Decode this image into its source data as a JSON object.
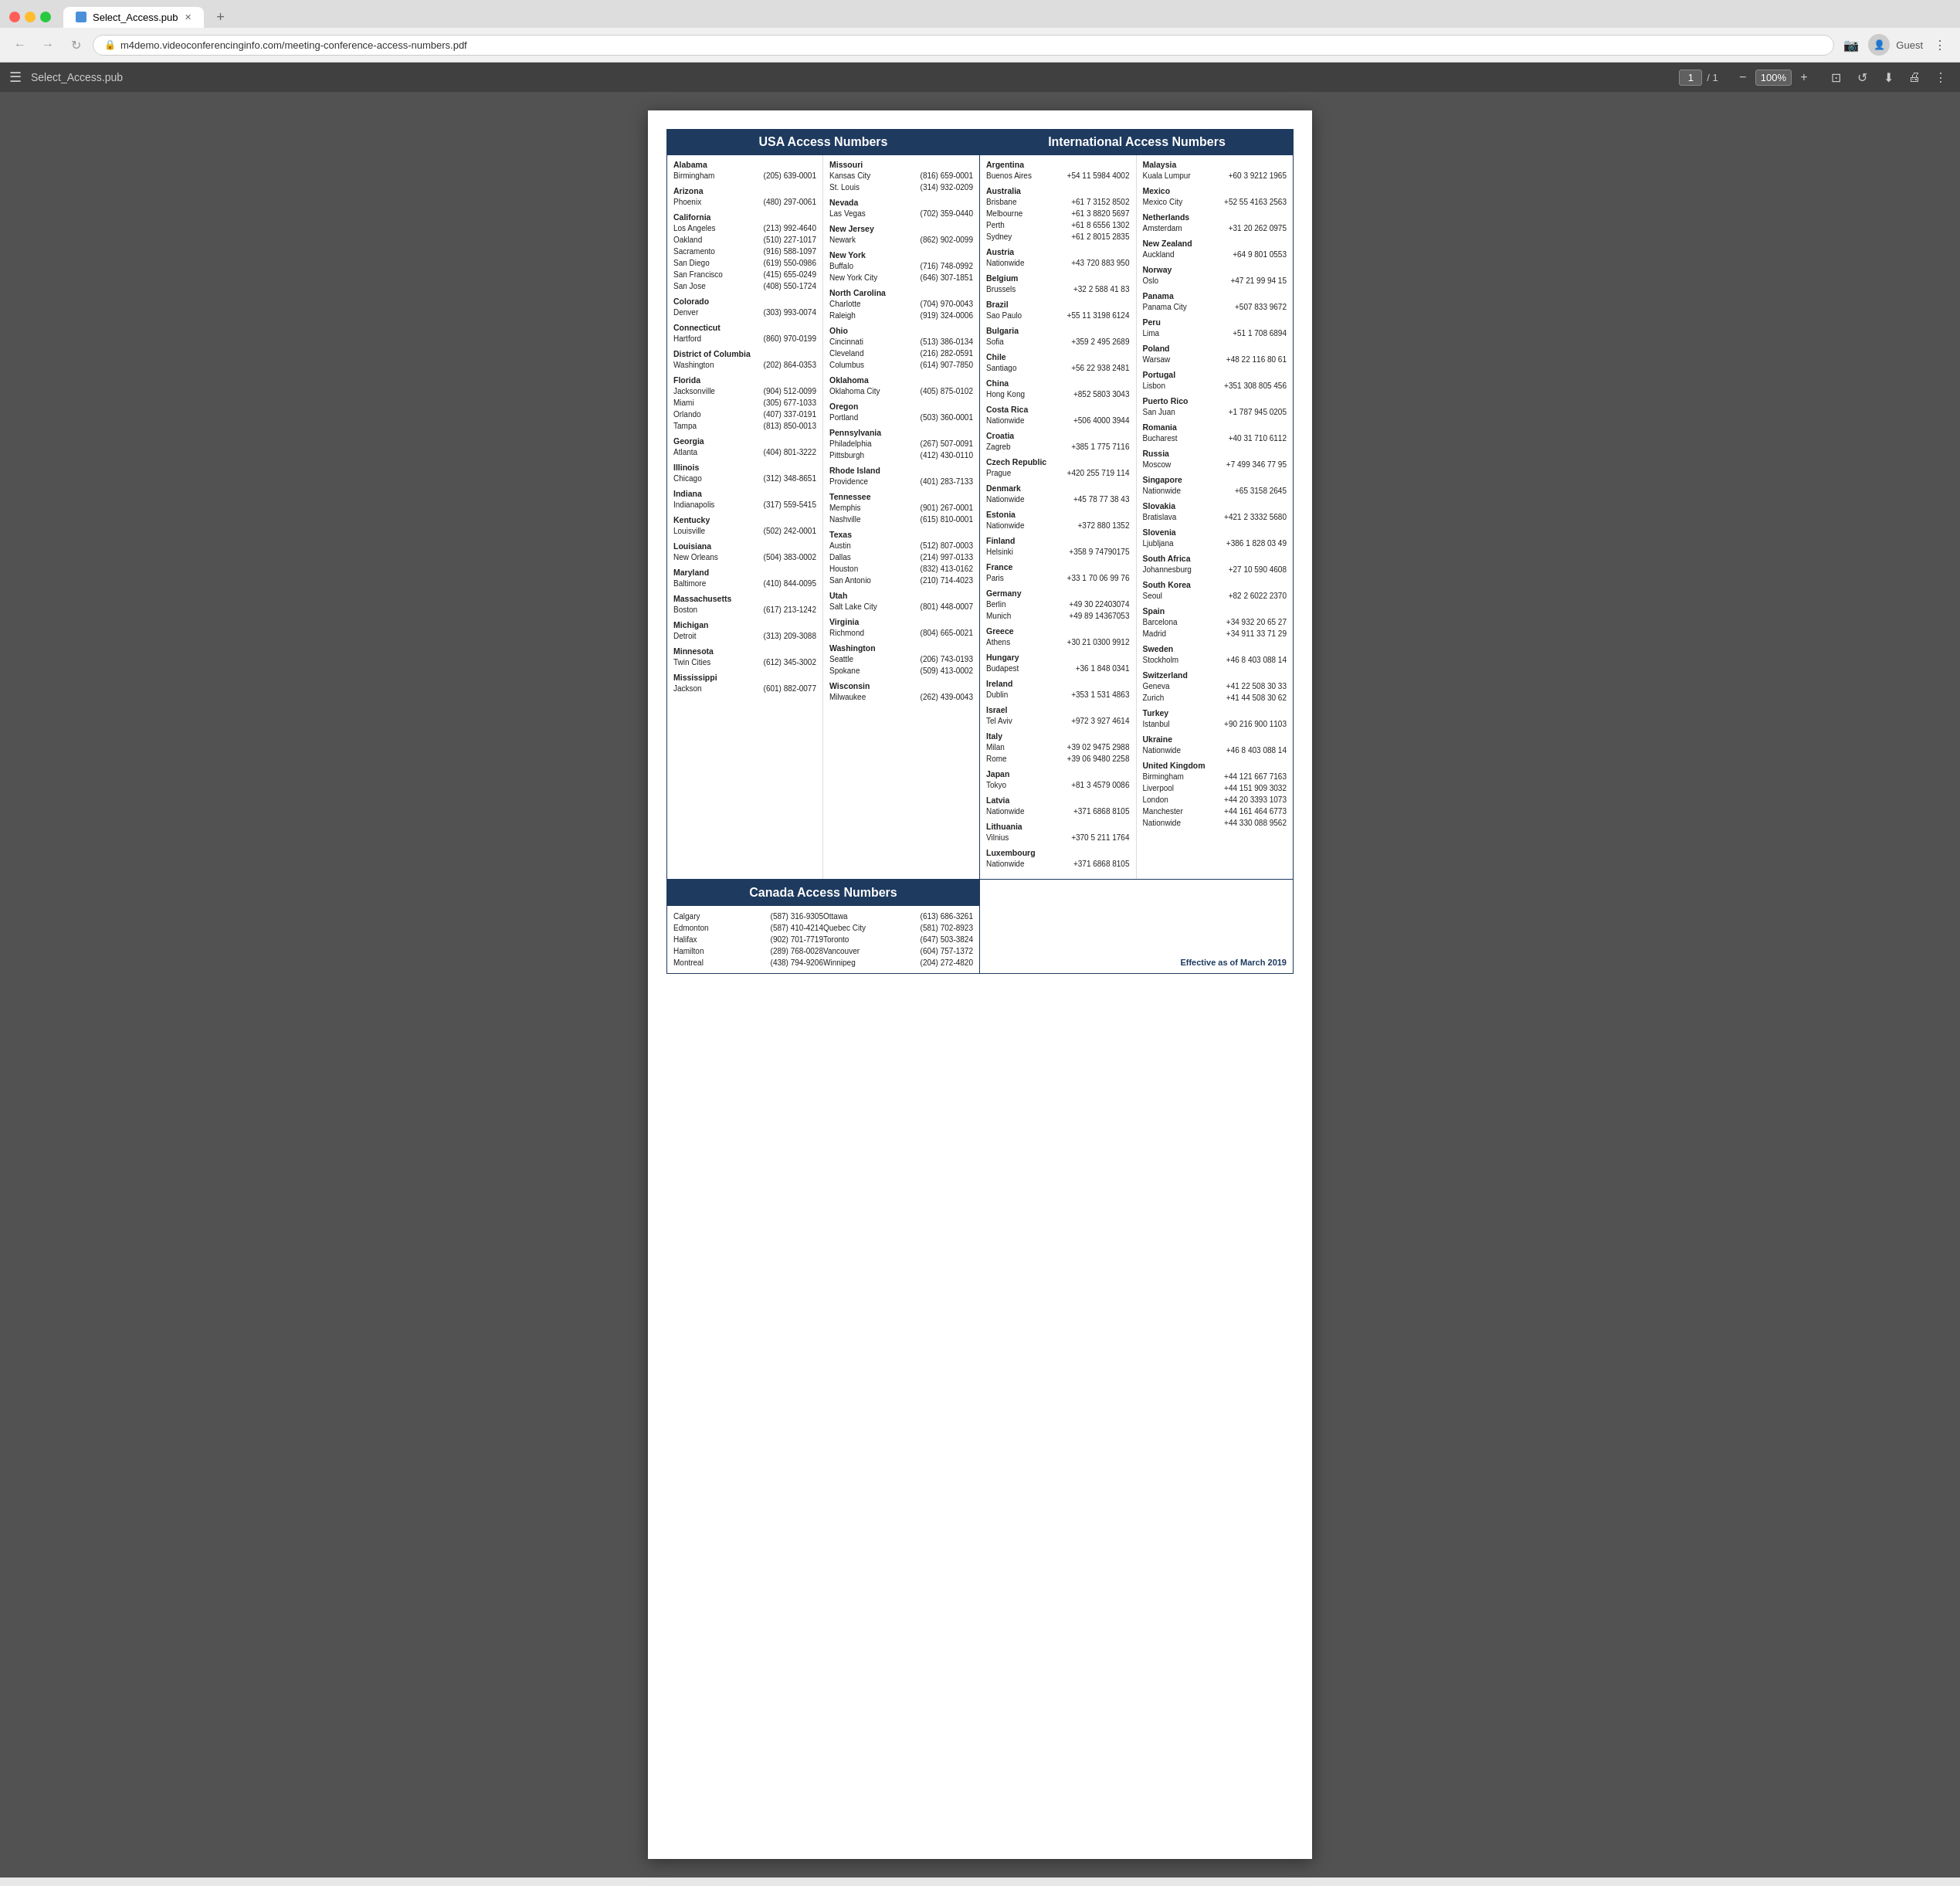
{
  "browser": {
    "tab_title": "Select_Access.pub",
    "url": "m4demo.videoconferencinginfo.com/meeting-conference-access-numbers.pdf",
    "page_indicator": "1 / 1",
    "zoom_level": "100%",
    "user_label": "Guest"
  },
  "pdf": {
    "title": "Select_Access.pub",
    "page_current": "1",
    "page_total": "1",
    "zoom": "100%"
  },
  "content": {
    "usa_header": "USA Access Numbers",
    "intl_header": "International Access Numbers",
    "canada_header": "Canada Access Numbers",
    "effective_date": "Effective as of March 2019",
    "usa_states": [
      {
        "state": "Alabama",
        "cities": [
          {
            "city": "Birmingham",
            "phone": "(205) 639-0001"
          }
        ]
      },
      {
        "state": "Arizona",
        "cities": [
          {
            "city": "Phoenix",
            "phone": "(480) 297-0061"
          }
        ]
      },
      {
        "state": "California",
        "cities": [
          {
            "city": "Los Angeles",
            "phone": "(213) 992-4640"
          },
          {
            "city": "Oakland",
            "phone": "(510) 227-1017"
          },
          {
            "city": "Sacramento",
            "phone": "(916) 588-1097"
          },
          {
            "city": "San Diego",
            "phone": "(619) 550-0986"
          },
          {
            "city": "San Francisco",
            "phone": "(415) 655-0249"
          },
          {
            "city": "San Jose",
            "phone": "(408) 550-1724"
          }
        ]
      },
      {
        "state": "Colorado",
        "cities": [
          {
            "city": "Denver",
            "phone": "(303) 993-0074"
          }
        ]
      },
      {
        "state": "Connecticut",
        "cities": [
          {
            "city": "Hartford",
            "phone": "(860) 970-0199"
          }
        ]
      },
      {
        "state": "District of Columbia",
        "cities": [
          {
            "city": "Washington",
            "phone": "(202) 864-0353"
          }
        ]
      },
      {
        "state": "Florida",
        "cities": [
          {
            "city": "Jacksonville",
            "phone": "(904) 512-0099"
          },
          {
            "city": "Miami",
            "phone": "(305) 677-1033"
          },
          {
            "city": "Orlando",
            "phone": "(407) 337-0191"
          },
          {
            "city": "Tampa",
            "phone": "(813) 850-0013"
          }
        ]
      },
      {
        "state": "Georgia",
        "cities": [
          {
            "city": "Atlanta",
            "phone": "(404) 801-3222"
          }
        ]
      },
      {
        "state": "Illinois",
        "cities": [
          {
            "city": "Chicago",
            "phone": "(312) 348-8651"
          }
        ]
      },
      {
        "state": "Indiana",
        "cities": [
          {
            "city": "Indianapolis",
            "phone": "(317) 559-5415"
          }
        ]
      },
      {
        "state": "Kentucky",
        "cities": [
          {
            "city": "Louisville",
            "phone": "(502) 242-0001"
          }
        ]
      },
      {
        "state": "Louisiana",
        "cities": [
          {
            "city": "New Orleans",
            "phone": "(504) 383-0002"
          }
        ]
      },
      {
        "state": "Maryland",
        "cities": [
          {
            "city": "Baltimore",
            "phone": "(410) 844-0095"
          }
        ]
      },
      {
        "state": "Massachusetts",
        "cities": [
          {
            "city": "Boston",
            "phone": "(617) 213-1242"
          }
        ]
      },
      {
        "state": "Michigan",
        "cities": [
          {
            "city": "Detroit",
            "phone": "(313) 209-3088"
          }
        ]
      },
      {
        "state": "Minnesota",
        "cities": [
          {
            "city": "Twin Cities",
            "phone": "(612) 345-3002"
          }
        ]
      },
      {
        "state": "Mississippi",
        "cities": [
          {
            "city": "Jackson",
            "phone": "(601) 882-0077"
          }
        ]
      }
    ],
    "usa_states_col2": [
      {
        "state": "Missouri",
        "cities": [
          {
            "city": "Kansas City",
            "phone": "(816) 659-0001"
          },
          {
            "city": "St. Louis",
            "phone": "(314) 932-0209"
          }
        ]
      },
      {
        "state": "Nevada",
        "cities": [
          {
            "city": "Las Vegas",
            "phone": "(702) 359-0440"
          }
        ]
      },
      {
        "state": "New Jersey",
        "cities": [
          {
            "city": "Newark",
            "phone": "(862) 902-0099"
          }
        ]
      },
      {
        "state": "New York",
        "cities": [
          {
            "city": "Buffalo",
            "phone": "(716) 748-0992"
          },
          {
            "city": "New York City",
            "phone": "(646) 307-1851"
          }
        ]
      },
      {
        "state": "North Carolina",
        "cities": [
          {
            "city": "Charlotte",
            "phone": "(704) 970-0043"
          },
          {
            "city": "Raleigh",
            "phone": "(919) 324-0006"
          }
        ]
      },
      {
        "state": "Ohio",
        "cities": [
          {
            "city": "Cincinnati",
            "phone": "(513) 386-0134"
          },
          {
            "city": "Cleveland",
            "phone": "(216) 282-0591"
          },
          {
            "city": "Columbus",
            "phone": "(614) 907-7850"
          }
        ]
      },
      {
        "state": "Oklahoma",
        "cities": [
          {
            "city": "Oklahoma City",
            "phone": "(405) 875-0102"
          }
        ]
      },
      {
        "state": "Oregon",
        "cities": [
          {
            "city": "Portland",
            "phone": "(503) 360-0001"
          }
        ]
      },
      {
        "state": "Pennsylvania",
        "cities": [
          {
            "city": "Philadelphia",
            "phone": "(267) 507-0091"
          },
          {
            "city": "Pittsburgh",
            "phone": "(412) 430-0110"
          }
        ]
      },
      {
        "state": "Rhode Island",
        "cities": [
          {
            "city": "Providence",
            "phone": "(401) 283-7133"
          }
        ]
      },
      {
        "state": "Tennessee",
        "cities": [
          {
            "city": "Memphis",
            "phone": "(901) 267-0001"
          },
          {
            "city": "Nashville",
            "phone": "(615) 810-0001"
          }
        ]
      },
      {
        "state": "Texas",
        "cities": [
          {
            "city": "Austin",
            "phone": "(512) 807-0003"
          },
          {
            "city": "Dallas",
            "phone": "(214) 997-0133"
          },
          {
            "city": "Houston",
            "phone": "(832) 413-0162"
          },
          {
            "city": "San Antonio",
            "phone": "(210) 714-4023"
          }
        ]
      },
      {
        "state": "Utah",
        "cities": [
          {
            "city": "Salt Lake City",
            "phone": "(801) 448-0007"
          }
        ]
      },
      {
        "state": "Virginia",
        "cities": [
          {
            "city": "Richmond",
            "phone": "(804) 665-0021"
          }
        ]
      },
      {
        "state": "Washington",
        "cities": [
          {
            "city": "Seattle",
            "phone": "(206) 743-0193"
          },
          {
            "city": "Spokane",
            "phone": "(509) 413-0002"
          }
        ]
      },
      {
        "state": "Wisconsin",
        "cities": [
          {
            "city": "Milwaukee",
            "phone": "(262) 439-0043"
          }
        ]
      }
    ],
    "international": [
      {
        "country": "Argentina",
        "cities": [
          {
            "city": "Buenos Aires",
            "phone": "+54 11 5984 4002"
          }
        ]
      },
      {
        "country": "Australia",
        "cities": [
          {
            "city": "Brisbane",
            "phone": "+61 7 3152 8502"
          },
          {
            "city": "Melbourne",
            "phone": "+61 3 8820 5697"
          },
          {
            "city": "Perth",
            "phone": "+61 8 6556 1302"
          },
          {
            "city": "Sydney",
            "phone": "+61 2 8015 2835"
          }
        ]
      },
      {
        "country": "Austria",
        "cities": [
          {
            "city": "Nationwide",
            "phone": "+43 720 883 950"
          }
        ]
      },
      {
        "country": "Belgium",
        "cities": [
          {
            "city": "Brussels",
            "phone": "+32 2 588 41 83"
          }
        ]
      },
      {
        "country": "Brazil",
        "cities": [
          {
            "city": "Sao Paulo",
            "phone": "+55 11 3198 6124"
          }
        ]
      },
      {
        "country": "Bulgaria",
        "cities": [
          {
            "city": "Sofia",
            "phone": "+359 2 495 2689"
          }
        ]
      },
      {
        "country": "Chile",
        "cities": [
          {
            "city": "Santiago",
            "phone": "+56 22 938 2481"
          }
        ]
      },
      {
        "country": "China",
        "cities": [
          {
            "city": "Hong Kong",
            "phone": "+852 5803 3043"
          }
        ]
      },
      {
        "country": "Costa Rica",
        "cities": [
          {
            "city": "Nationwide",
            "phone": "+506 4000 3944"
          }
        ]
      },
      {
        "country": "Croatia",
        "cities": [
          {
            "city": "Zagreb",
            "phone": "+385 1 775 7116"
          }
        ]
      },
      {
        "country": "Czech Republic",
        "cities": [
          {
            "city": "Prague",
            "phone": "+420 255 719 114"
          }
        ]
      },
      {
        "country": "Denmark",
        "cities": [
          {
            "city": "Nationwide",
            "phone": "+45 78 77 38 43"
          }
        ]
      },
      {
        "country": "Estonia",
        "cities": [
          {
            "city": "Nationwide",
            "phone": "+372 880 1352"
          }
        ]
      },
      {
        "country": "Finland",
        "cities": [
          {
            "city": "Helsinki",
            "phone": "+358 9 74790175"
          }
        ]
      },
      {
        "country": "France",
        "cities": [
          {
            "city": "Paris",
            "phone": "+33 1 70 06 99 76"
          }
        ]
      },
      {
        "country": "Germany",
        "cities": [
          {
            "city": "Berlin",
            "phone": "+49 30 22403074"
          },
          {
            "city": "Munich",
            "phone": "+49 89 14367053"
          }
        ]
      },
      {
        "country": "Greece",
        "cities": [
          {
            "city": "Athens",
            "phone": "+30 21 0300 9912"
          }
        ]
      },
      {
        "country": "Hungary",
        "cities": [
          {
            "city": "Budapest",
            "phone": "+36 1 848 0341"
          }
        ]
      },
      {
        "country": "Ireland",
        "cities": [
          {
            "city": "Dublin",
            "phone": "+353 1 531 4863"
          }
        ]
      },
      {
        "country": "Israel",
        "cities": [
          {
            "city": "Tel Aviv",
            "phone": "+972 3 927 4614"
          }
        ]
      },
      {
        "country": "Italy",
        "cities": [
          {
            "city": "Milan",
            "phone": "+39 02 9475 2988"
          },
          {
            "city": "Rome",
            "phone": "+39 06 9480 2258"
          }
        ]
      },
      {
        "country": "Japan",
        "cities": [
          {
            "city": "Tokyo",
            "phone": "+81 3 4579 0086"
          }
        ]
      },
      {
        "country": "Latvia",
        "cities": [
          {
            "city": "Nationwide",
            "phone": "+371 6868 8105"
          }
        ]
      },
      {
        "country": "Lithuania",
        "cities": [
          {
            "city": "Vilnius",
            "phone": "+370 5 211 1764"
          }
        ]
      },
      {
        "country": "Luxembourg",
        "cities": [
          {
            "city": "Nationwide",
            "phone": "+371 6868 8105"
          }
        ]
      }
    ],
    "international_col2": [
      {
        "country": "Malaysia",
        "cities": [
          {
            "city": "Kuala Lumpur",
            "phone": "+60 3 9212 1965"
          }
        ]
      },
      {
        "country": "Mexico",
        "cities": [
          {
            "city": "Mexico City",
            "phone": "+52 55 4163 2563"
          }
        ]
      },
      {
        "country": "Netherlands",
        "cities": [
          {
            "city": "Amsterdam",
            "phone": "+31 20 262 0975"
          }
        ]
      },
      {
        "country": "New Zealand",
        "cities": [
          {
            "city": "Auckland",
            "phone": "+64 9 801 0553"
          }
        ]
      },
      {
        "country": "Norway",
        "cities": [
          {
            "city": "Oslo",
            "phone": "+47 21 99 94 15"
          }
        ]
      },
      {
        "country": "Panama",
        "cities": [
          {
            "city": "Panama City",
            "phone": "+507 833 9672"
          }
        ]
      },
      {
        "country": "Peru",
        "cities": [
          {
            "city": "Lima",
            "phone": "+51 1 708 6894"
          }
        ]
      },
      {
        "country": "Poland",
        "cities": [
          {
            "city": "Warsaw",
            "phone": "+48 22 116 80 61"
          }
        ]
      },
      {
        "country": "Portugal",
        "cities": [
          {
            "city": "Lisbon",
            "phone": "+351 308 805 456"
          }
        ]
      },
      {
        "country": "Puerto Rico",
        "cities": [
          {
            "city": "San Juan",
            "phone": "+1 787 945 0205"
          }
        ]
      },
      {
        "country": "Romania",
        "cities": [
          {
            "city": "Bucharest",
            "phone": "+40 31 710 6112"
          }
        ]
      },
      {
        "country": "Russia",
        "cities": [
          {
            "city": "Moscow",
            "phone": "+7 499 346 77 95"
          }
        ]
      },
      {
        "country": "Singapore",
        "cities": [
          {
            "city": "Nationwide",
            "phone": "+65 3158 2645"
          }
        ]
      },
      {
        "country": "Slovakia",
        "cities": [
          {
            "city": "Bratislava",
            "phone": "+421 2 3332 5680"
          }
        ]
      },
      {
        "country": "Slovenia",
        "cities": [
          {
            "city": "Ljubljana",
            "phone": "+386 1 828 03 49"
          }
        ]
      },
      {
        "country": "South Africa",
        "cities": [
          {
            "city": "Johannesburg",
            "phone": "+27 10 590 4608"
          }
        ]
      },
      {
        "country": "South Korea",
        "cities": [
          {
            "city": "Seoul",
            "phone": "+82 2 6022 2370"
          }
        ]
      },
      {
        "country": "Spain",
        "cities": [
          {
            "city": "Barcelona",
            "phone": "+34 932 20 65 27"
          },
          {
            "city": "Madrid",
            "phone": "+34 911 33 71 29"
          }
        ]
      },
      {
        "country": "Sweden",
        "cities": [
          {
            "city": "Stockholm",
            "phone": "+46 8 403 088 14"
          }
        ]
      },
      {
        "country": "Switzerland",
        "cities": [
          {
            "city": "Geneva",
            "phone": "+41 22 508 30 33"
          },
          {
            "city": "Zurich",
            "phone": "+41 44 508 30 62"
          }
        ]
      },
      {
        "country": "Turkey",
        "cities": [
          {
            "city": "Istanbul",
            "phone": "+90 216 900 1103"
          }
        ]
      },
      {
        "country": "Ukraine",
        "cities": [
          {
            "city": "Nationwide",
            "phone": "+46 8 403 088 14"
          }
        ]
      },
      {
        "country": "United Kingdom",
        "cities": [
          {
            "city": "Birmingham",
            "phone": "+44 121 667 7163"
          },
          {
            "city": "Liverpool",
            "phone": "+44 151 909 3032"
          },
          {
            "city": "London",
            "phone": "+44 20 3393 1073"
          },
          {
            "city": "Manchester",
            "phone": "+44 161 464 6773"
          },
          {
            "city": "Nationwide",
            "phone": "+44 330 088 9562"
          }
        ]
      }
    ],
    "canada_col1": [
      {
        "city": "Calgary",
        "phone": "(587) 316-9305"
      },
      {
        "city": "Edmonton",
        "phone": "(587) 410-4214"
      },
      {
        "city": "Halifax",
        "phone": "(902) 701-7719"
      },
      {
        "city": "Hamilton",
        "phone": "(289) 768-0028"
      },
      {
        "city": "Montreal",
        "phone": "(438) 794-9206"
      }
    ],
    "canada_col2": [
      {
        "city": "Ottawa",
        "phone": "(613) 686-3261"
      },
      {
        "city": "Quebec City",
        "phone": "(581) 702-8923"
      },
      {
        "city": "Toronto",
        "phone": "(647) 503-3824"
      },
      {
        "city": "Vancouver",
        "phone": "(604) 757-1372"
      },
      {
        "city": "Winnipeg",
        "phone": "(204) 272-4820"
      }
    ]
  }
}
